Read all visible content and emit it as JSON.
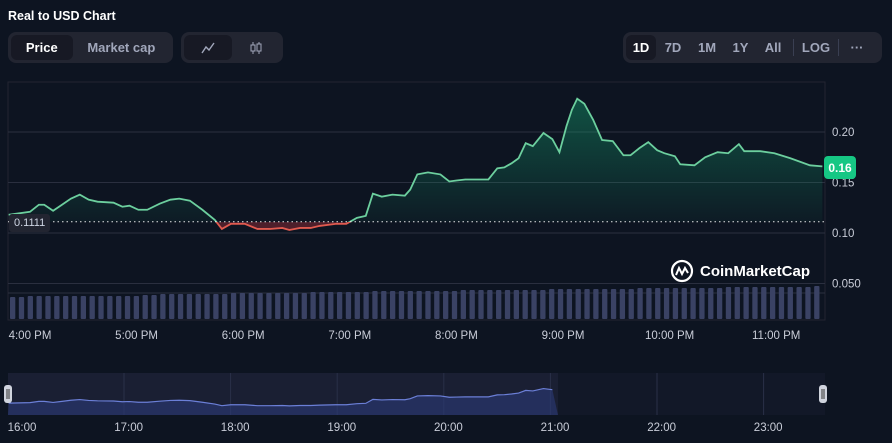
{
  "header": {
    "title": "Real to USD Chart"
  },
  "toggle": {
    "price": "Price",
    "market_cap": "Market cap",
    "active": "Price"
  },
  "chart_type": {
    "line_icon": "line-chart-icon",
    "candle_icon": "candlestick-icon",
    "active": "line"
  },
  "ranges": {
    "items": [
      "1D",
      "7D",
      "1M",
      "1Y",
      "All"
    ],
    "active": "1D",
    "log": "LOG",
    "more": "···"
  },
  "watermark": "CoinMarketCap",
  "colors": {
    "up": "#16c784",
    "down": "#ea3943",
    "line_up": "#6ccf9e",
    "line_down": "#e05a4f",
    "volume": "#3a4264",
    "navigator": "#6b7fd7"
  },
  "chart_data": {
    "type": "line",
    "reference_value": 0.1111,
    "reference_label": "0.1111",
    "current_label": "0.16",
    "ylim": [
      0.03,
      0.245
    ],
    "yticks": [
      "0.20",
      "0.15",
      "0.10",
      "0.050"
    ],
    "ytick_values": [
      0.2,
      0.15,
      0.1,
      0.05
    ],
    "xticks": [
      "4:00 PM",
      "5:00 PM",
      "6:00 PM",
      "7:00 PM",
      "8:00 PM",
      "9:00 PM",
      "10:00 PM",
      "11:00 PM"
    ],
    "nav_xticks": [
      "16:00",
      "17:00",
      "18:00",
      "19:00",
      "20:00",
      "21:00",
      "22:00",
      "23:00"
    ],
    "grid": true,
    "x": [
      "15:48",
      "16:00",
      "16:05",
      "16:08",
      "16:13",
      "16:18",
      "16:23",
      "16:28",
      "16:33",
      "16:38",
      "16:47",
      "16:52",
      "16:56",
      "17:01",
      "17:06",
      "17:13",
      "17:19",
      "17:24",
      "17:30",
      "17:37",
      "17:44",
      "17:48",
      "17:53",
      "18:01",
      "18:08",
      "18:15",
      "18:22",
      "18:26",
      "18:32",
      "18:38",
      "18:43",
      "18:52",
      "18:58",
      "19:04",
      "19:09",
      "19:13",
      "19:18",
      "19:24",
      "19:31",
      "19:34",
      "19:38",
      "19:44",
      "19:51",
      "19:56",
      "20:00",
      "20:05",
      "20:10",
      "20:18",
      "20:23",
      "20:27",
      "20:31",
      "20:35",
      "20:39",
      "20:43",
      "20:49",
      "20:54",
      "20:58",
      "21:02",
      "21:05",
      "21:08",
      "21:12",
      "21:17",
      "21:22",
      "21:28",
      "21:34",
      "21:38",
      "21:43",
      "21:48",
      "21:53",
      "21:57",
      "22:03",
      "22:06",
      "22:14",
      "22:20",
      "22:27",
      "22:33",
      "22:39",
      "22:42",
      "22:51",
      "22:59",
      "23:08",
      "23:19",
      "23:26"
    ],
    "y": [
      0.118,
      0.121,
      0.128,
      0.128,
      0.122,
      0.128,
      0.134,
      0.138,
      0.133,
      0.131,
      0.13,
      0.126,
      0.127,
      0.123,
      0.123,
      0.129,
      0.133,
      0.134,
      0.132,
      0.123,
      0.113,
      0.104,
      0.109,
      0.109,
      0.104,
      0.104,
      0.105,
      0.103,
      0.105,
      0.105,
      0.107,
      0.109,
      0.109,
      0.115,
      0.117,
      0.139,
      0.136,
      0.138,
      0.137,
      0.143,
      0.158,
      0.16,
      0.158,
      0.151,
      0.152,
      0.153,
      0.153,
      0.153,
      0.164,
      0.165,
      0.169,
      0.174,
      0.189,
      0.186,
      0.199,
      0.193,
      0.18,
      0.206,
      0.222,
      0.233,
      0.228,
      0.212,
      0.192,
      0.191,
      0.177,
      0.177,
      0.184,
      0.19,
      0.182,
      0.179,
      0.176,
      0.168,
      0.167,
      0.175,
      0.18,
      0.179,
      0.188,
      0.181,
      0.181,
      0.179,
      0.174,
      0.167,
      0.166
    ],
    "volume_relative": [
      22,
      22,
      23,
      23,
      23,
      23,
      23,
      23,
      23,
      23,
      23,
      23,
      23,
      23,
      23,
      24,
      24,
      25,
      25,
      25,
      25,
      25,
      25,
      25,
      25,
      26,
      26,
      26,
      26,
      26,
      26,
      26,
      26,
      26,
      27,
      27,
      27,
      27,
      27,
      27,
      27,
      28,
      28,
      28,
      28,
      28,
      28,
      28,
      28,
      28,
      28,
      29,
      29,
      29,
      29,
      29,
      29,
      29,
      29,
      29,
      29,
      30,
      30,
      30,
      30,
      30,
      30,
      30,
      30,
      30,
      30,
      31,
      31,
      31,
      31,
      31,
      31,
      31,
      31,
      31,
      31,
      32,
      32,
      32,
      32,
      32,
      32,
      32,
      32,
      32,
      32,
      33
    ]
  }
}
